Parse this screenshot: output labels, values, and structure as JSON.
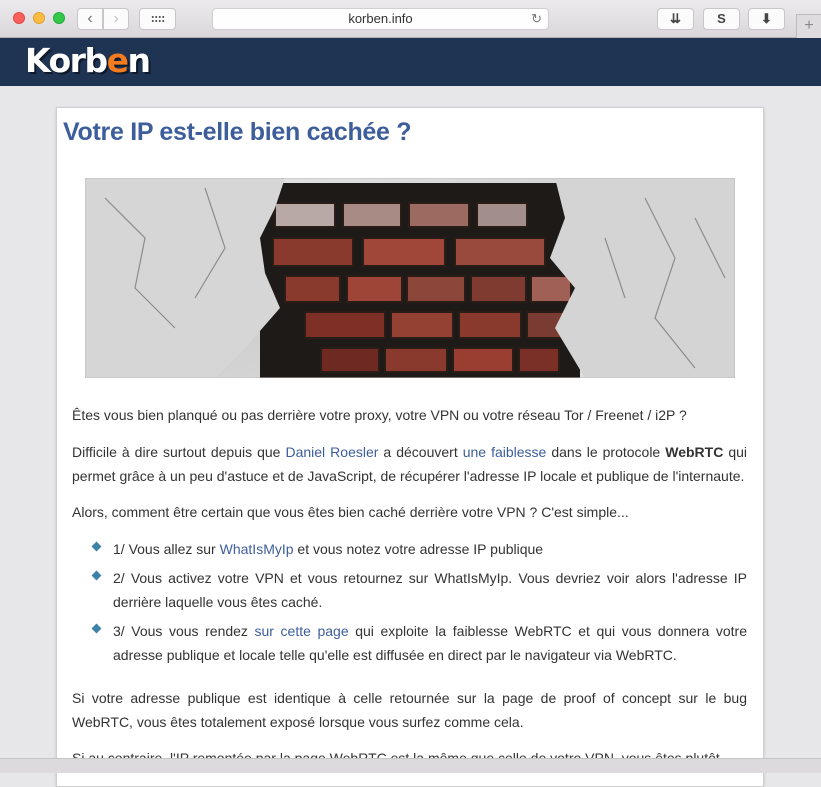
{
  "browser": {
    "url": "korben.info",
    "back_icon": "‹",
    "forward_icon": "›",
    "reload_icon": "↻",
    "toolbar": {
      "btn1_icon": "⇊",
      "btn2_label": "S",
      "btn3_icon": "⬇"
    },
    "newtab_icon": "+"
  },
  "site": {
    "logo_pre": "Korb",
    "logo_accent": "e",
    "logo_post": "n",
    "accent_color": "#f47c20",
    "header_color": "#1f3352"
  },
  "article": {
    "title": "Votre IP est-elle bien cachée ?",
    "p1": "Êtes vous bien planqué ou pas derrière votre proxy, votre VPN ou votre réseau Tor / Freenet / i2P ?",
    "p2_a": "Difficile à dire surtout depuis que ",
    "p2_link1": "Daniel Roesler",
    "p2_b": " a découvert ",
    "p2_link2": "une faiblesse",
    "p2_c": " dans le protocole ",
    "p2_bold": "WebRTC",
    "p2_d": " qui permet grâce à un peu d'astuce et de JavaScript, de récupérer l'adresse IP locale et publique de l'internaute.",
    "p3": "Alors, comment être certain que vous êtes bien caché derrière votre VPN ? C'est simple...",
    "li1_a": "1/ Vous allez sur ",
    "li1_link": "WhatIsMyIp",
    "li1_b": " et vous notez votre adresse IP publique",
    "li2": "2/ Vous activez votre VPN et vous retournez sur WhatIsMyIp. Vous devriez voir alors l'adresse IP derrière laquelle vous êtes caché.",
    "li3_a": "3/ Vous vous rendez ",
    "li3_link": "sur cette page",
    "li3_b": " qui exploite la faiblesse WebRTC et qui vous donnera votre adresse publique et locale telle qu'elle est diffusée en direct par le navigateur via WebRTC.",
    "p4": "Si votre adresse publique est identique à celle retournée sur la page de proof of concept sur le bug WebRTC, vous êtes totalement exposé lorsque vous surfez comme cela.",
    "p5": "Si au contraire, l'IP remontée par la page WebRTC est la même que celle de votre VPN, vous êtes plutôt"
  }
}
